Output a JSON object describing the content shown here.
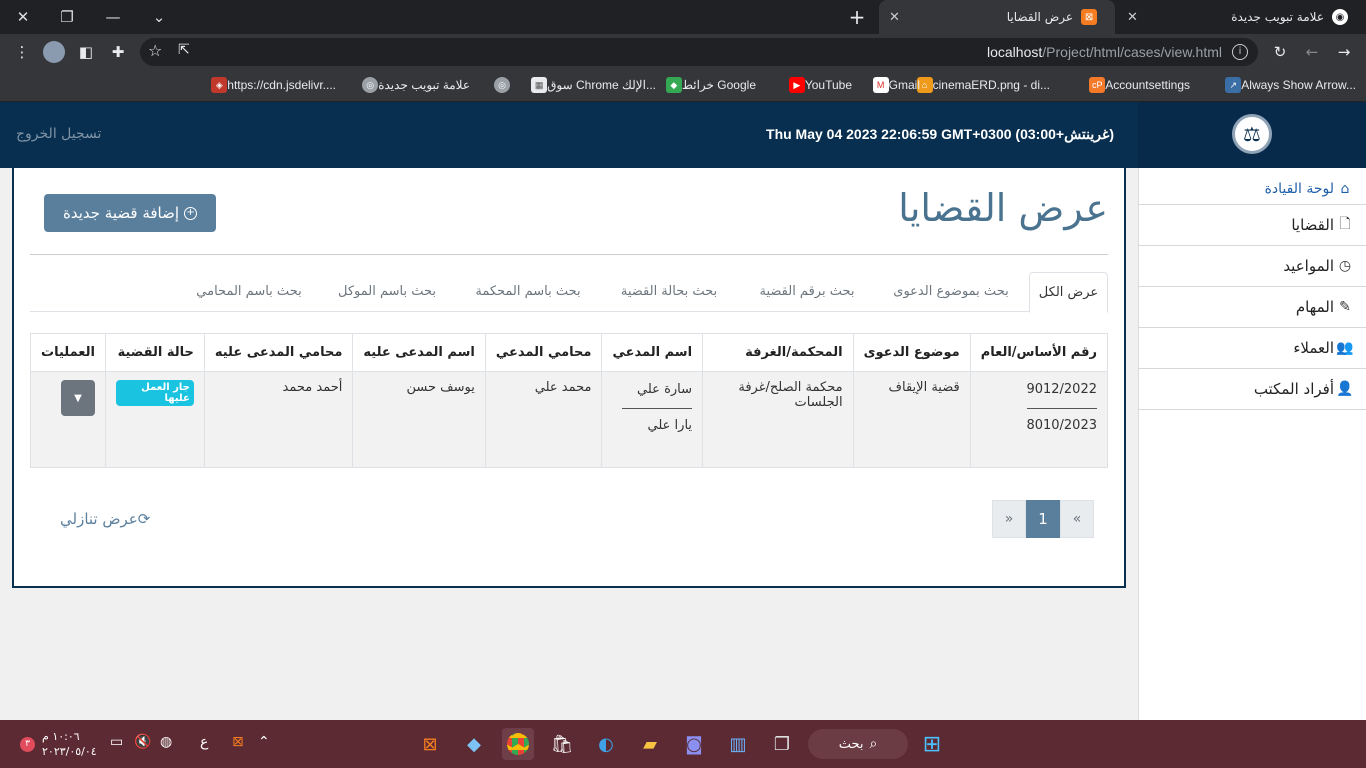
{
  "browser": {
    "tabs": [
      {
        "title": "علامة تبويب جديدة",
        "active": false
      },
      {
        "title": "عرض القضايا",
        "active": true
      }
    ],
    "url_host": "localhost",
    "url_path": "/Project/html/cases/view.html",
    "bookmarks": [
      "Always Show Arrow...",
      "Accountsettings",
      "cinemaERD.png - di...",
      "Gmail",
      "YouTube",
      "خرائط Google",
      "سوق Chrome الإلك...",
      "علامة تبويب جديدة",
      "https://cdn.jsdelivr...."
    ]
  },
  "header": {
    "logout": "تسجيل الخروج",
    "datetime": "Thu May 04 2023 22:06:59 GMT+0300 (غرينتش+03:00)"
  },
  "sidebar": {
    "items": [
      {
        "label": "لوحة القيادة",
        "icon": "home-icon"
      },
      {
        "label": "القضايا",
        "icon": "file-icon"
      },
      {
        "label": "المواعيد",
        "icon": "clock-icon"
      },
      {
        "label": "المهام",
        "icon": "tasks-icon"
      },
      {
        "label": "العملاء",
        "icon": "users-icon"
      },
      {
        "label": "أفراد المكتب",
        "icon": "user-icon"
      }
    ]
  },
  "page": {
    "title": "عرض القضايا",
    "add_button": "إضافة قضية جديدة",
    "search_tabs": [
      "عرض الكل",
      "بحث بموضوع الدعوى",
      "بحث برقم القضية",
      "بحث بحالة القضية",
      "بحث باسم المحكمة",
      "بحث باسم الموكل",
      "بحث باسم المحامي"
    ]
  },
  "table": {
    "headers": [
      "رقم الأساس/العام",
      "موضوع الدعوى",
      "المحكمة/الغرفة",
      "اسم المدعي",
      "محامي المدعي",
      "اسم المدعى عليه",
      "محامي المدعى عليه",
      "حالة القضية",
      "العمليات"
    ],
    "rows": [
      {
        "case_number_1": "9012/2022",
        "case_number_2": "8010/2023",
        "subject": "قضية الإيقاف",
        "court": "محكمة الصلح/غرفة الجلسات",
        "plaintiff_1": "سارة علي",
        "plaintiff_2": "يارا علي",
        "plaintiff_lawyer": "محمد علي",
        "defendant": "يوسف حسن",
        "defendant_lawyer": "أحمد محمد",
        "status": "جار العمل عليها"
      }
    ]
  },
  "pagination": {
    "prev": "«",
    "current": "1",
    "next": "»"
  },
  "sort_toggle": "عرض تنازلي",
  "taskbar": {
    "search": "بحث",
    "lang": "ع",
    "time": "١٠:٠٦ م",
    "date": "٢٠٢٣/٠٥/٠٤",
    "notifications": "٣"
  },
  "colors": {
    "header_bg": "#082f4f",
    "accent": "#5a7f9d",
    "badge": "#1ac4e0",
    "taskbar": "#5b2a33"
  }
}
